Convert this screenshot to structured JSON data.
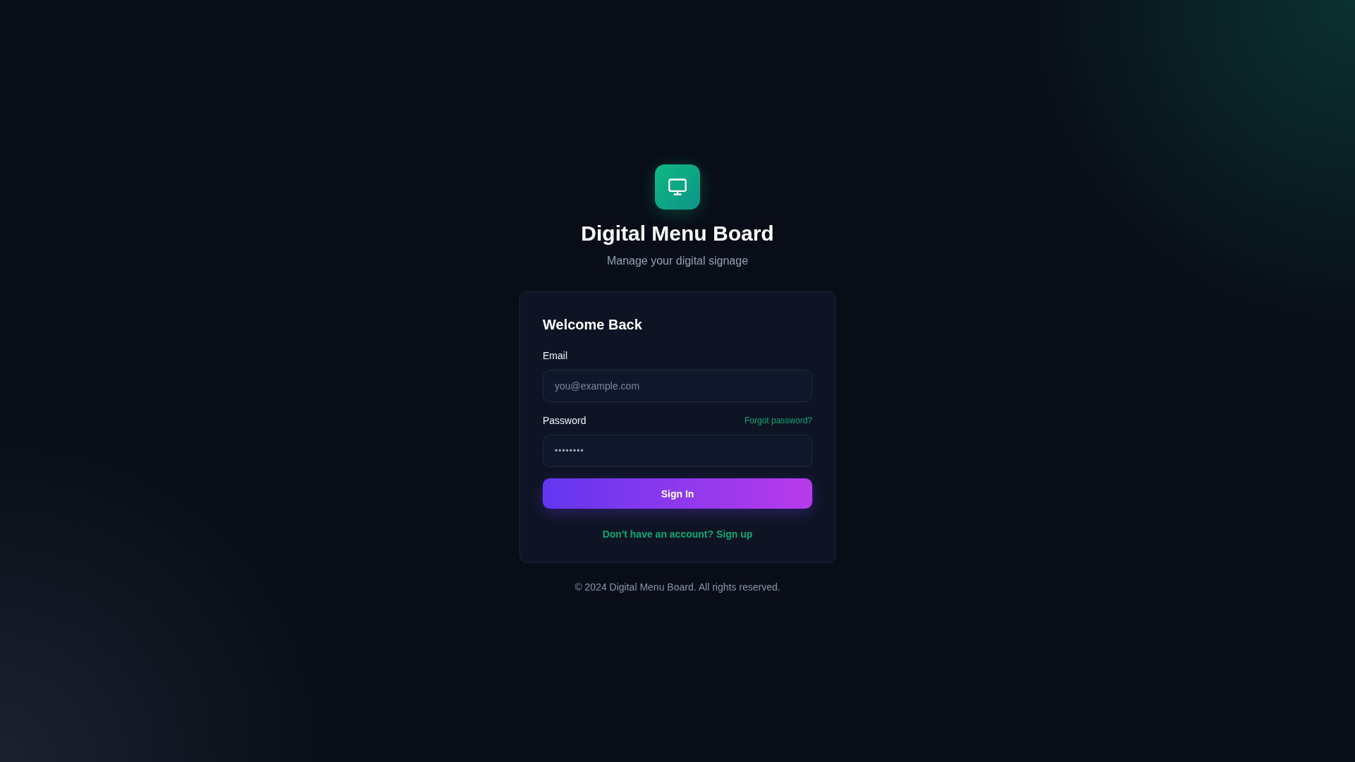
{
  "brand": {
    "title": "Digital Menu Board",
    "subtitle": "Manage your digital signage"
  },
  "card": {
    "title": "Welcome Back",
    "fields": [
      {
        "label": "Email",
        "placeholder": "you@example.com",
        "kind": "email"
      },
      {
        "label": "Password",
        "placeholder": "••••••••",
        "kind": "password",
        "link": "Forgot password?"
      }
    ],
    "submit": "Sign In",
    "signup_link": "Don't have an account? Sign up"
  },
  "footer": "© 2024 Digital Menu Board. All rights reserved."
}
